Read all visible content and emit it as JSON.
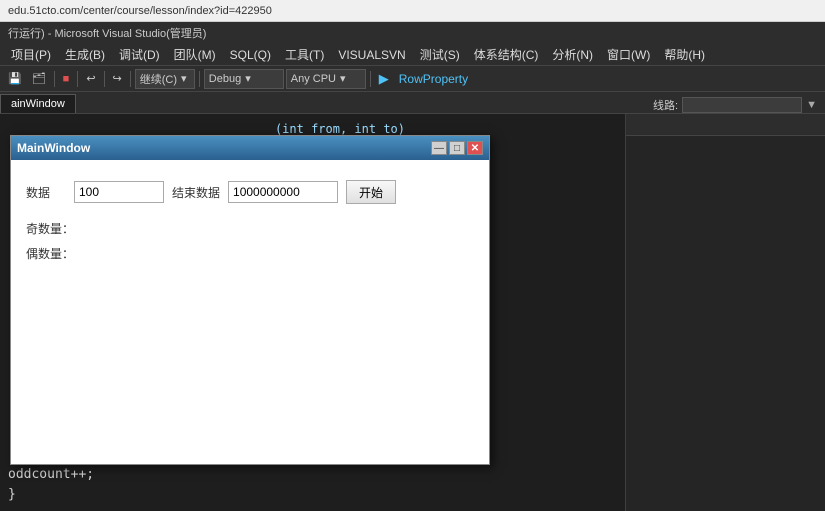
{
  "browser": {
    "url": "edu.51cto.com/center/course/lesson/index?id=422950"
  },
  "ide": {
    "title": "行运行) - Microsoft Visual Studio(管理员)",
    "menu": [
      {
        "label": "项目(P)"
      },
      {
        "label": "生成(B)"
      },
      {
        "label": "调试(D)"
      },
      {
        "label": "团队(M)"
      },
      {
        "label": "SQL(Q)"
      },
      {
        "label": "工具(T)"
      },
      {
        "label": "VISUALSVN"
      },
      {
        "label": "测试(S)"
      },
      {
        "label": "体系结构(C)"
      },
      {
        "label": "分析(N)"
      },
      {
        "label": "窗口(W)"
      },
      {
        "label": "帮助(H)"
      }
    ],
    "toolbar": {
      "debug_mode": "Debug",
      "cpu": "Any CPU",
      "row_property": "RowProperty",
      "continue_label": "继续(C)"
    },
    "tab": {
      "label": "ainWindow"
    },
    "right_panel": {
      "search_placeholder": "线路:",
      "code_hint": "(int from, int to)"
    },
    "code": [
      {
        "line": "oddcount++;"
      },
      {
        "line": "}"
      }
    ]
  },
  "dialog": {
    "title": "MainWindow",
    "controls": {
      "minimize": "—",
      "maximize": "□",
      "close": "✕"
    },
    "start_data_label": "数据",
    "start_data_value": "100",
    "end_data_label": "结束数据",
    "end_data_value": "1000000000",
    "start_button": "开始",
    "result1_label": "奇数量：",
    "result2_label": "偶数量："
  }
}
